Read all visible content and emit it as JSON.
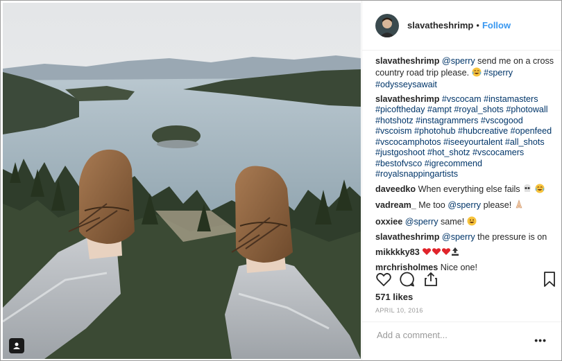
{
  "post": {
    "username": "slavatheshrimp",
    "follow_label": "Follow",
    "separator": "•"
  },
  "comments": [
    {
      "user": "slavatheshrimp",
      "mention": "@sperry",
      "text": " send me on a cross country road trip please. ",
      "emoji": "crying-laughing",
      "tags": " #sperry #odysseysawait"
    },
    {
      "user": "slavatheshrimp",
      "tags": " #vscocam #instamasters #picoftheday #ampt #royal_shots #photowall #hotshotz #instagrammers #vscogood #vscoism #photohub #hubcreative #openfeed #vscocamphotos #iseeyourtalent #all_shots #justgoshoot #hot_shotz #vscocamers #bestofvsco #igrecommend #royalsnappingartists"
    },
    {
      "user": "daveedko",
      "text": " When everything else fails ",
      "emoji": "skull, crying-laughing"
    },
    {
      "user": "vadream_",
      "text": " Me too ",
      "mention": "@sperry",
      "text2": " please! ",
      "emoji": "praying-hands"
    },
    {
      "user": "oxxiee",
      "mention": "@sperry",
      "text": " same! ",
      "emoji": "grinning"
    },
    {
      "user": "slavatheshrimp",
      "mention": "@sperry",
      "text": " the pressure is on"
    },
    {
      "user": "mikkkky83",
      "emoji": "heart, heart, heart, top"
    },
    {
      "user": "mrchrisholmes",
      "text": " Nice one!"
    }
  ],
  "actions": {
    "like_icon": "heart-outline-icon",
    "comment_icon": "speech-bubble-icon",
    "share_icon": "share-icon",
    "save_icon": "bookmark-icon"
  },
  "likes": "571 likes",
  "date": "APRIL 10, 2016",
  "add_comment_placeholder": "Add a comment...",
  "more_label": "•••",
  "colors": {
    "follow": "#3897f0",
    "hashtag": "#003569",
    "text": "#262626"
  }
}
